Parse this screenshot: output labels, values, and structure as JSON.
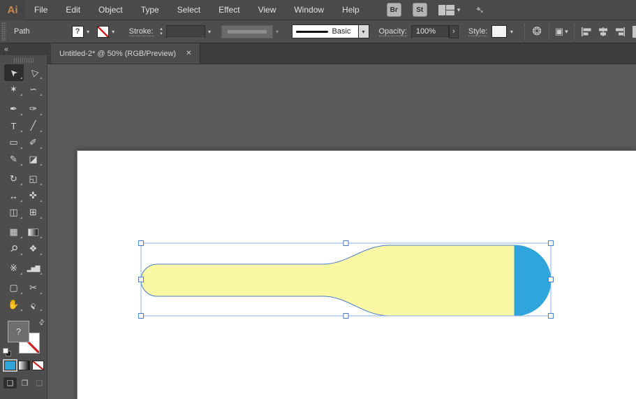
{
  "app": {
    "logo_text": "Ai"
  },
  "menubar": {
    "menus": [
      "File",
      "Edit",
      "Object",
      "Type",
      "Select",
      "Effect",
      "View",
      "Window",
      "Help"
    ],
    "bridge_button": "Br",
    "stock_button": "St",
    "workspace_chevron": "▾",
    "gpu_glyph": "➴"
  },
  "controlbar": {
    "selection_type_label": "Path",
    "fill_unknown": "?",
    "stroke_label": "Stroke:",
    "stepper_up": "▴",
    "stepper_down": "▾",
    "chevron": "▾",
    "brush_name": "Basic",
    "opacity_label": "Opacity:",
    "opacity_value": "100%",
    "opacity_arrow": "›",
    "style_label": "Style:",
    "recolor_glyph": "❂",
    "select_similar_glyph": "▣"
  },
  "tabbar": {
    "title": "Untitled-2* @ 50% (RGB/Preview)",
    "close": "✕"
  },
  "toolbar": {
    "collapse": "«",
    "tools": [
      {
        "name": "Selection Tool",
        "glyph": "➤"
      },
      {
        "name": "Direct Selection Tool",
        "glyph": "▷"
      },
      {
        "name": "Magic Wand Tool",
        "glyph": "✶"
      },
      {
        "name": "Lasso Tool",
        "glyph": "∽"
      },
      {
        "name": "Pen Tool",
        "glyph": "✒"
      },
      {
        "name": "Curvature Tool",
        "glyph": "✑"
      },
      {
        "name": "Type Tool",
        "glyph": "T"
      },
      {
        "name": "Line Segment Tool",
        "glyph": "╱"
      },
      {
        "name": "Rectangle Tool",
        "glyph": "▭"
      },
      {
        "name": "Paintbrush Tool",
        "glyph": "✐"
      },
      {
        "name": "Shaper Tool",
        "glyph": "✎"
      },
      {
        "name": "Eraser Tool",
        "glyph": "◪"
      },
      {
        "name": "Rotate Tool",
        "glyph": "↻"
      },
      {
        "name": "Scale Tool",
        "glyph": "◱"
      },
      {
        "name": "Width Tool",
        "glyph": "↔"
      },
      {
        "name": "Puppet Warp Tool",
        "glyph": "✜"
      },
      {
        "name": "Shape Builder Tool",
        "glyph": "◫"
      },
      {
        "name": "Perspective Grid Tool",
        "glyph": "⊞"
      },
      {
        "name": "Mesh Tool",
        "glyph": "▦"
      },
      {
        "name": "Gradient Tool",
        "glyph": "▧"
      },
      {
        "name": "Eyedropper Tool",
        "glyph": "⚲"
      },
      {
        "name": "Blend Tool",
        "glyph": "❖"
      },
      {
        "name": "Symbol Sprayer Tool",
        "glyph": "※"
      },
      {
        "name": "Column Graph Tool",
        "glyph": "▂▅▇"
      },
      {
        "name": "Artboard Tool",
        "glyph": "▢"
      },
      {
        "name": "Slice Tool",
        "glyph": "✂"
      },
      {
        "name": "Hand Tool",
        "glyph": "✋"
      },
      {
        "name": "Zoom Tool",
        "glyph": "○"
      }
    ],
    "fill_unknown": "?",
    "swap_glyph": "⇄",
    "draw_modes": [
      {
        "name": "Draw Normal",
        "glyph": "❏"
      },
      {
        "name": "Draw Behind",
        "glyph": "❐"
      },
      {
        "name": "Draw Inside",
        "glyph": "❑"
      }
    ]
  },
  "canvas": {
    "shape": {
      "body_color": "#FAF7A5",
      "cap_color": "#30A5DC",
      "outline_color": "#4A7CC8"
    },
    "selection": {
      "box_color": "#8FB2E5",
      "handle_fill": "#FFFFFF",
      "handle_border": "#4A7CC8"
    },
    "swatch_blue": "#30A5DC"
  },
  "colors": {
    "ui_bar": "#4A4A4A",
    "ui_panel": "#4D4D4D",
    "ui_strip": "#3D3D3D",
    "pasteboard": "#5A5A5A",
    "logo_orange": "#C98A4E",
    "none_red": "#CC2222"
  }
}
